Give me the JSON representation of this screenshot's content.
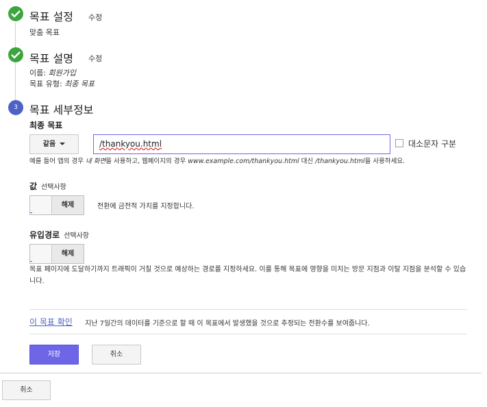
{
  "steps": [
    {
      "title": "목표 설정",
      "edit_label": "수정",
      "status": "complete",
      "summary_line": "맞춤 목표"
    },
    {
      "title": "목표 설명",
      "edit_label": "수정",
      "status": "complete",
      "name_label": "이름:",
      "name_value": "회원가입",
      "type_label": "목표 유형:",
      "type_value": "최종 목표"
    },
    {
      "number": "3",
      "title": "목표 세부정보",
      "status": "active"
    }
  ],
  "destination": {
    "label": "최종 목표",
    "match_type": "같음",
    "value": "/thankyou.html",
    "case_sensitive_label": "대소문자 구분",
    "case_sensitive": false,
    "help": {
      "p1": "예를 들어 앱의 경우 ",
      "app_example": "내 화면",
      "p2": "을 사용하고, 웹페이지의 경우 ",
      "web_full": "www.example.com/thankyou.html",
      "p3": " 대신 ",
      "web_short": "/thankyou.html",
      "p4": "을 사용하세요."
    }
  },
  "value_field": {
    "label": "값",
    "optional": "선택사항",
    "toggle_state": "해제",
    "description": "전환에 금전적 가치를 지정합니다."
  },
  "funnel": {
    "label": "유입경로",
    "optional": "선택사항",
    "toggle_state": "해제",
    "description": "목표 페이지에 도달하기까지 트래픽이 거칠 것으로 예상하는 경로를 지정하세요. 이를 통해 목표에 영향을 미치는 방문 지점과 이탈 지점을 분석할 수 있습니다."
  },
  "verify": {
    "link": "이 목표 확인",
    "description": "지난 7일간의 데이터를 기준으로 할 때 이 목표에서 발생했을 것으로 추정되는 전환수를 보여줍니다."
  },
  "actions": {
    "save": "저장",
    "cancel": "취소"
  },
  "footer": {
    "cancel": "취소"
  },
  "colors": {
    "complete": "#3da53f",
    "active_step": "#4c62c4",
    "primary": "#6e66e6",
    "link": "#4c62c4"
  }
}
